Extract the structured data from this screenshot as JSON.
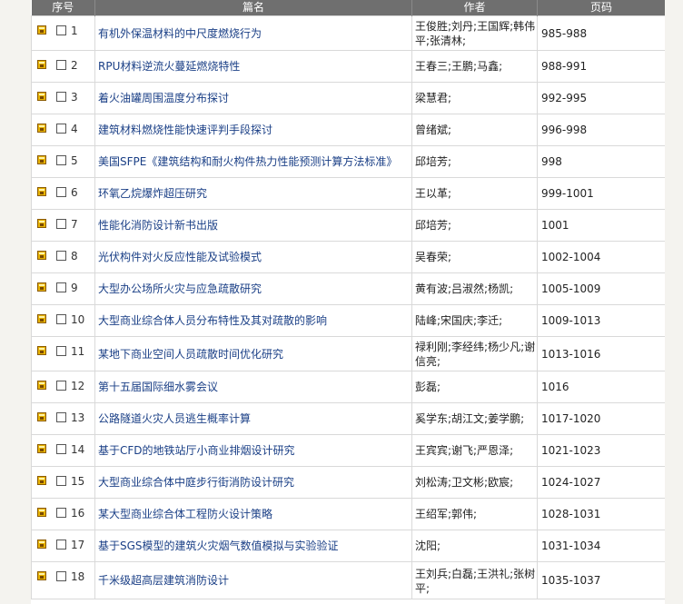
{
  "headers": {
    "seq": "序号",
    "title": "篇名",
    "author": "作者",
    "pages": "页码"
  },
  "rows": [
    {
      "num": "1",
      "title": "有机外保温材料的中尺度燃烧行为",
      "author": "王俊胜;刘丹;王国辉;韩伟平;张清林;",
      "pages": "985-988"
    },
    {
      "num": "2",
      "title": "RPU材料逆流火蔓延燃烧特性",
      "author": "王春三;王鹏;马鑫;",
      "pages": "988-991"
    },
    {
      "num": "3",
      "title": "着火油罐周围温度分布探讨",
      "author": "梁慧君;",
      "pages": "992-995"
    },
    {
      "num": "4",
      "title": "建筑材料燃烧性能快速评判手段探讨",
      "author": "曾绪斌;",
      "pages": "996-998"
    },
    {
      "num": "5",
      "title": "美国SFPE《建筑结构和耐火构件热力性能预测计算方法标准》",
      "author": "邱培芳;",
      "pages": "998"
    },
    {
      "num": "6",
      "title": "环氧乙烷爆炸超压研究",
      "author": "王以革;",
      "pages": "999-1001"
    },
    {
      "num": "7",
      "title": "性能化消防设计新书出版",
      "author": "邱培芳;",
      "pages": "1001"
    },
    {
      "num": "8",
      "title": "光伏构件对火反应性能及试验模式",
      "author": "吴春荣;",
      "pages": "1002-1004"
    },
    {
      "num": "9",
      "title": "大型办公场所火灾与应急疏散研究",
      "author": "黄有波;吕淑然;杨凯;",
      "pages": "1005-1009"
    },
    {
      "num": "10",
      "title": "大型商业综合体人员分布特性及其对疏散的影响",
      "author": "陆峰;宋国庆;李迁;",
      "pages": "1009-1013"
    },
    {
      "num": "11",
      "title": "某地下商业空间人员疏散时间优化研究",
      "author": "禄利刚;李经纬;杨少凡;谢信亮;",
      "pages": "1013-1016"
    },
    {
      "num": "12",
      "title": "第十五届国际细水雾会议",
      "author": "彭磊;",
      "pages": "1016"
    },
    {
      "num": "13",
      "title": "公路隧道火灾人员逃生概率计算",
      "author": "奚学东;胡江文;姜学鹏;",
      "pages": "1017-1020"
    },
    {
      "num": "14",
      "title": "基于CFD的地铁站厅小商业排烟设计研究",
      "author": "王宾宾;谢飞;严恩泽;",
      "pages": "1021-1023"
    },
    {
      "num": "15",
      "title": "大型商业综合体中庭步行街消防设计研究",
      "author": "刘松涛;卫文彬;欧宸;",
      "pages": "1024-1027"
    },
    {
      "num": "16",
      "title": "某大型商业综合体工程防火设计策略",
      "author": "王绍军;郭伟;",
      "pages": "1028-1031"
    },
    {
      "num": "17",
      "title": "基于SGS模型的建筑火灾烟气数值模拟与实验验证",
      "author": "沈阳;",
      "pages": "1031-1034"
    },
    {
      "num": "18",
      "title": "千米级超高层建筑消防设计",
      "author": "王刘兵;白磊;王洪礼;张树平;",
      "pages": "1035-1037"
    }
  ]
}
